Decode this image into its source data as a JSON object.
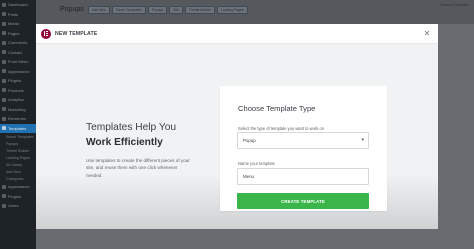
{
  "wp_admin": {
    "page_title": "Popups",
    "tabs": [
      "Add New",
      "Saved Templates",
      "Popups",
      "Kits",
      "Theme Builder",
      "Landing Pages"
    ],
    "screen_options": "Screen Options",
    "sidebar": [
      {
        "label": "Dashboard",
        "active": false
      },
      {
        "label": "Posts",
        "active": false
      },
      {
        "label": "Media",
        "active": false
      },
      {
        "label": "Pages",
        "active": false
      },
      {
        "label": "Comments",
        "active": false
      },
      {
        "label": "Contact",
        "active": false
      },
      {
        "label": "Front Menu",
        "active": false
      },
      {
        "label": "Appearance",
        "active": false
      },
      {
        "label": "Plugins",
        "active": false
      },
      {
        "label": "Products",
        "active": false
      },
      {
        "label": "Analytics",
        "active": false
      },
      {
        "label": "Marketing",
        "active": false
      },
      {
        "label": "Elementor",
        "active": false
      },
      {
        "label": "Templates",
        "active": true
      }
    ],
    "sidebar_sub": [
      "Saved Templates",
      "Popups",
      "Theme Builder",
      "Landing Pages",
      "Kit Library",
      "Add New",
      "Categories"
    ],
    "sidebar_bottom": [
      "Appearance",
      "Plugins",
      "Users"
    ]
  },
  "modal": {
    "title": "NEW TEMPLATE",
    "close_icon": "close-icon",
    "intro": {
      "title_line1": "Templates Help You",
      "title_line2": "Work Efficiently",
      "description": "Use templates to create the different pieces of your site, and reuse them with one click whenever needed."
    },
    "form": {
      "heading": "Choose Template Type",
      "type_label": "Select the type of template you want to work on",
      "type_value": "Popup",
      "name_label": "Name your template",
      "name_value": "Menu",
      "submit_label": "CREATE TEMPLATE"
    }
  },
  "colors": {
    "brand": "#92003b",
    "button": "#39b54a",
    "admin_accent": "#2271b1"
  }
}
